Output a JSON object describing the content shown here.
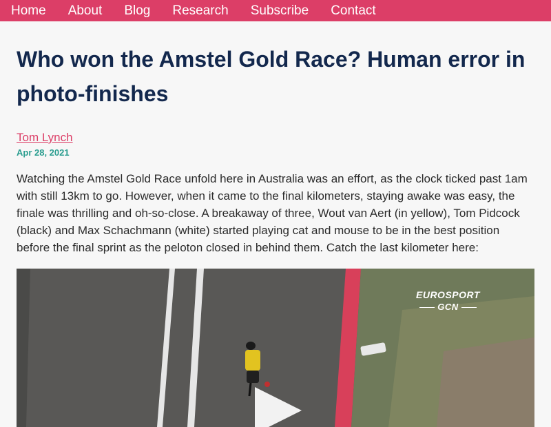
{
  "nav": {
    "items": [
      "Home",
      "About",
      "Blog",
      "Research",
      "Subscribe",
      "Contact"
    ]
  },
  "post": {
    "title": "Who won the Amstel Gold Race? Human error in photo-finishes",
    "author": "Tom Lynch",
    "date": "Apr 28, 2021",
    "intro": "Watching the Amstel Gold Race unfold here in Australia was an effort, as the clock ticked past 1am with still 13km to go. However, when it came to the final kilometers, staying awake was easy, the finale was thrilling and oh-so-close. A breakaway of three, Wout van Aert (in yellow), Tom Pidcock (black) and Max Schachmann (white) started playing cat and mouse to be in the best position before the final sprint as the peloton closed in behind them. Catch the last kilometer here:"
  },
  "video": {
    "logo_line1": "EUROSPORT",
    "logo_line2": "GCN"
  },
  "colors": {
    "nav_bg": "#dc3e67",
    "title": "#13284d",
    "author_link": "#dc3e67",
    "date": "#2a9d8f"
  }
}
